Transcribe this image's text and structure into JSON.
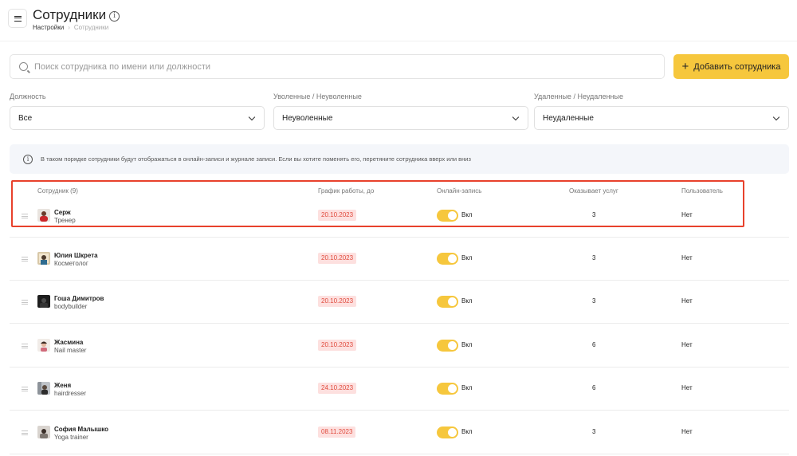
{
  "header": {
    "title": "Сотрудники",
    "breadcrumb": {
      "parent": "Настройки",
      "current": "Сотрудники"
    }
  },
  "search": {
    "placeholder": "Поиск сотрудника по имени или должности",
    "value": ""
  },
  "add_button": {
    "label": "Добавить сотрудника"
  },
  "filters": [
    {
      "label": "Должность",
      "value": "Все"
    },
    {
      "label": "Уволенные / Неуволенные",
      "value": "Неуволенные"
    },
    {
      "label": "Удаленные / Неудаленные",
      "value": "Неудаленные"
    }
  ],
  "notice": "В таком порядке сотрудники будут отображаться в онлайн-записи и журнале записи. Если вы хотите поменять его, перетяните сотрудника вверх или вниз",
  "table": {
    "headers": {
      "employee": "Сотрудник (9)",
      "schedule": "График работы, до",
      "online": "Онлайн-запись",
      "services": "Оказывает услуг",
      "user": "Пользователь"
    },
    "rows": [
      {
        "name": "Серж",
        "role": "Тренер",
        "schedule": "20.10.2023",
        "online_label": "Вкл",
        "online": true,
        "services": "3",
        "user": "Нет"
      },
      {
        "name": "Юлия Шкрета",
        "role": "Косметолог",
        "schedule": "20.10.2023",
        "online_label": "Вкл",
        "online": true,
        "services": "3",
        "user": "Нет"
      },
      {
        "name": "Гоша Димитров",
        "role": "bodybuilder",
        "schedule": "20.10.2023",
        "online_label": "Вкл",
        "online": true,
        "services": "3",
        "user": "Нет"
      },
      {
        "name": "Жасмина",
        "role": "Nail master",
        "schedule": "20.10.2023",
        "online_label": "Вкл",
        "online": true,
        "services": "6",
        "user": "Нет"
      },
      {
        "name": "Женя",
        "role": "hairdresser",
        "schedule": "24.10.2023",
        "online_label": "Вкл",
        "online": true,
        "services": "6",
        "user": "Нет"
      },
      {
        "name": "София Малышко",
        "role": "Yoga trainer",
        "schedule": "08.11.2023",
        "online_label": "Вкл",
        "online": true,
        "services": "3",
        "user": "Нет"
      }
    ]
  },
  "colors": {
    "accent": "#f6c73d",
    "highlight": "#e8412c",
    "date_badge_bg": "#fde0df",
    "date_badge_text": "#e04a3c"
  }
}
